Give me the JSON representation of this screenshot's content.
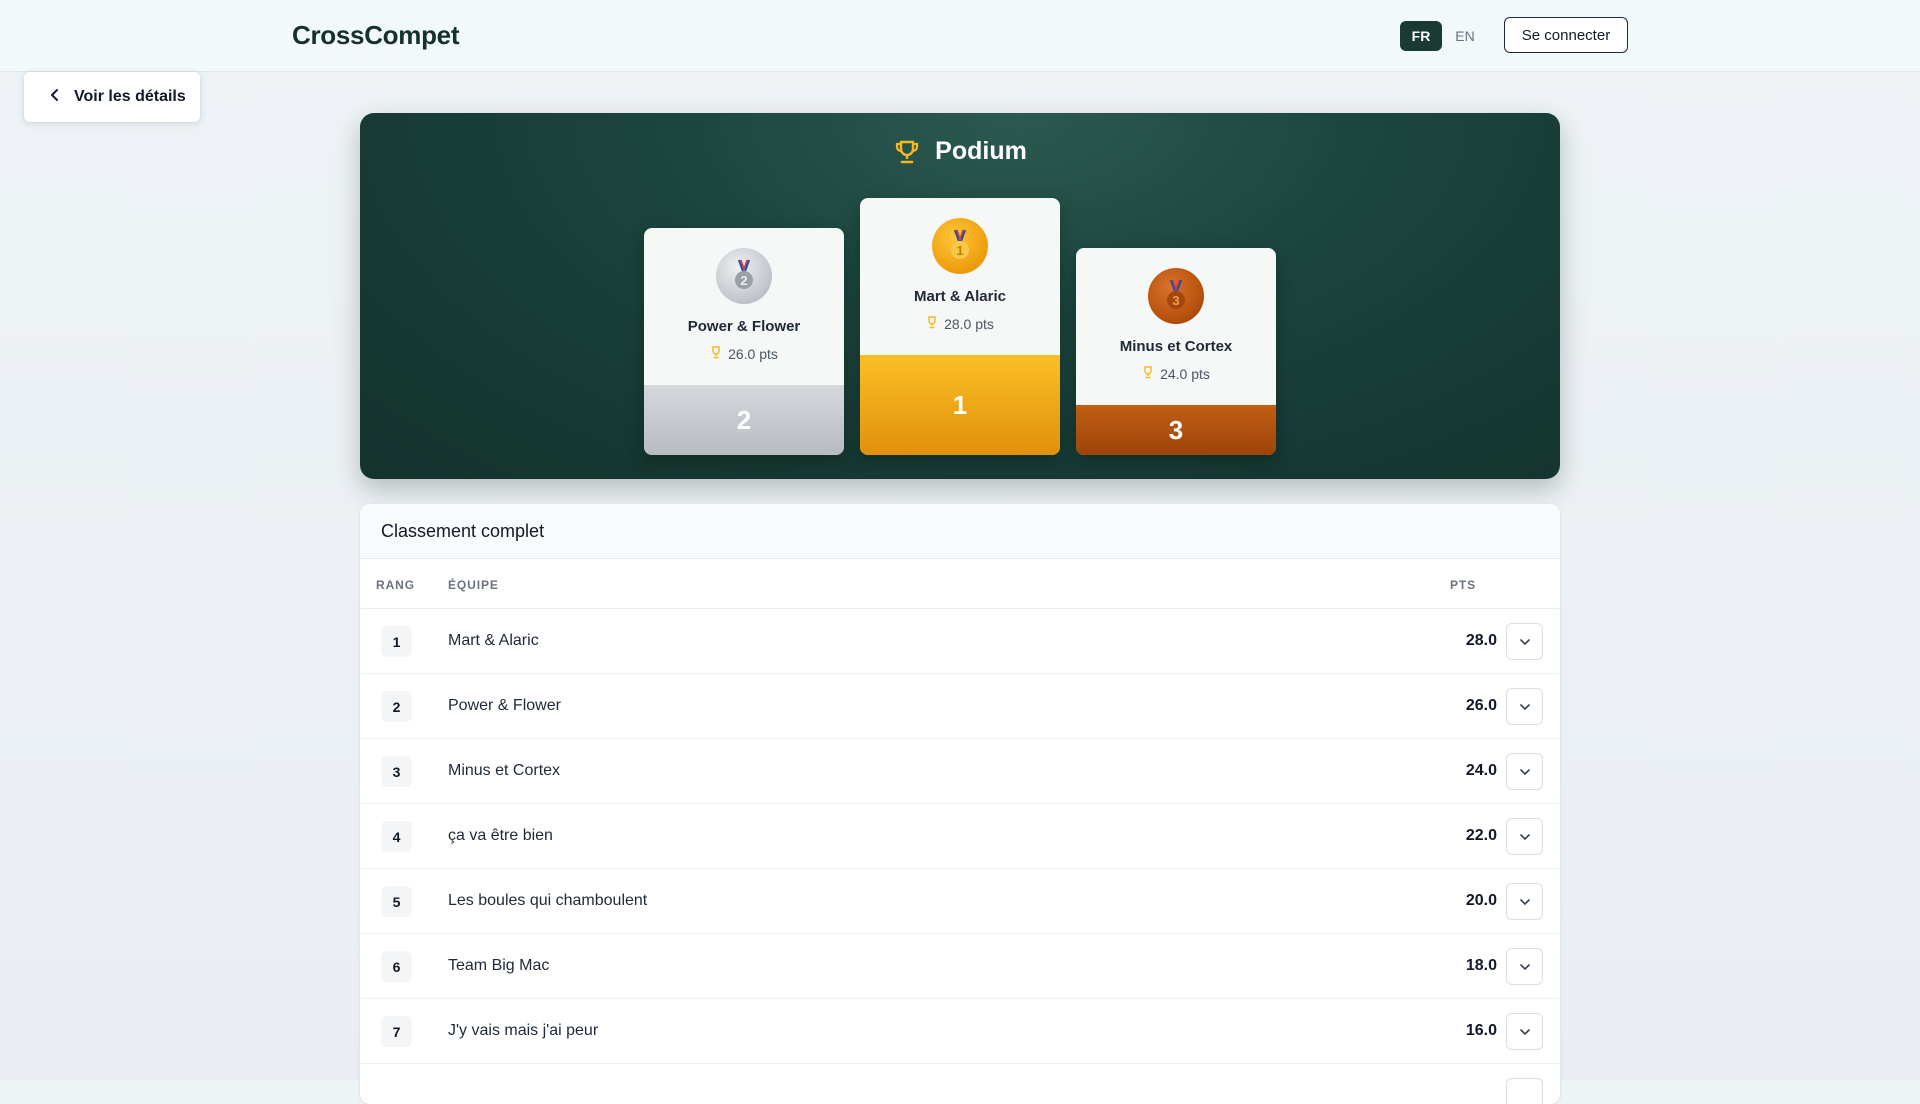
{
  "header": {
    "brand": "CrossCompet",
    "lang_fr": "FR",
    "lang_en": "EN",
    "login_label": "Se connecter"
  },
  "back_button": {
    "label": "Voir les détails"
  },
  "podium": {
    "title": "Podium",
    "entries": [
      {
        "place": "2",
        "medal_number": "2",
        "name": "Power & Flower",
        "points": "26.0 pts"
      },
      {
        "place": "1",
        "medal_number": "1",
        "name": "Mart & Alaric",
        "points": "28.0 pts"
      },
      {
        "place": "3",
        "medal_number": "3",
        "name": "Minus et Cortex",
        "points": "24.0 pts"
      }
    ]
  },
  "ranking": {
    "title": "Classement complet",
    "columns": {
      "rank": "RANG",
      "team": "ÉQUIPE",
      "points": "PTS"
    },
    "rows": [
      {
        "rank": "1",
        "team": "Mart & Alaric",
        "points": "28.0"
      },
      {
        "rank": "2",
        "team": "Power & Flower",
        "points": "26.0"
      },
      {
        "rank": "3",
        "team": "Minus et Cortex",
        "points": "24.0"
      },
      {
        "rank": "4",
        "team": "ça va être bien",
        "points": "22.0"
      },
      {
        "rank": "5",
        "team": "Les boules qui chamboulent",
        "points": "20.0"
      },
      {
        "rank": "6",
        "team": "Team Big Mac",
        "points": "18.0"
      },
      {
        "rank": "7",
        "team": "J'y vais mais j'ai peur",
        "points": "16.0"
      }
    ]
  },
  "colors": {
    "brand_dark": "#1a3a34",
    "gold": "#f0a212",
    "silver": "#c4c7cd",
    "bronze": "#b9530e"
  },
  "icons": {
    "back": "chevron-left-icon",
    "trophy": "trophy-icon",
    "medal": "medal-icon",
    "expand": "chevron-down-icon"
  }
}
